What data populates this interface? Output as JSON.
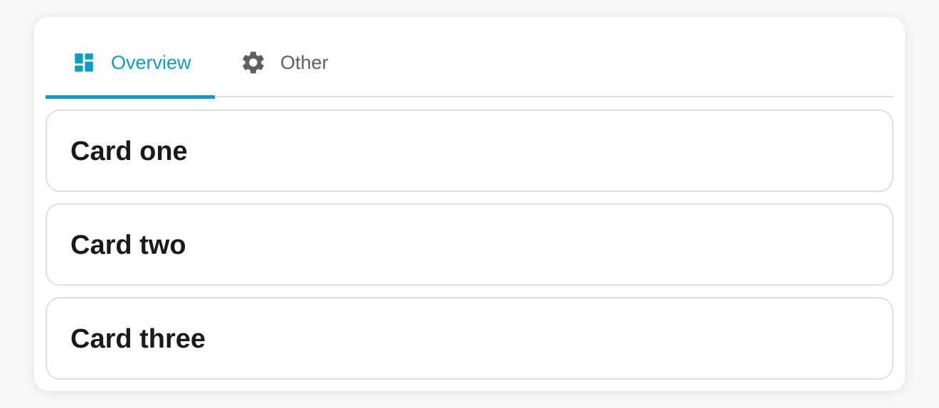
{
  "tabs": [
    {
      "label": "Overview",
      "icon": "dashboard-icon",
      "selected": true
    },
    {
      "label": "Other",
      "icon": "gear-icon",
      "selected": false
    }
  ],
  "cards": [
    {
      "title": "Card one"
    },
    {
      "title": "Card two"
    },
    {
      "title": "Card three"
    }
  ],
  "colors": {
    "accent": "#0a9dc7",
    "inactive_text": "#5f5f5f",
    "card_title": "#1a1a1a",
    "border": "#e0e0e0"
  }
}
